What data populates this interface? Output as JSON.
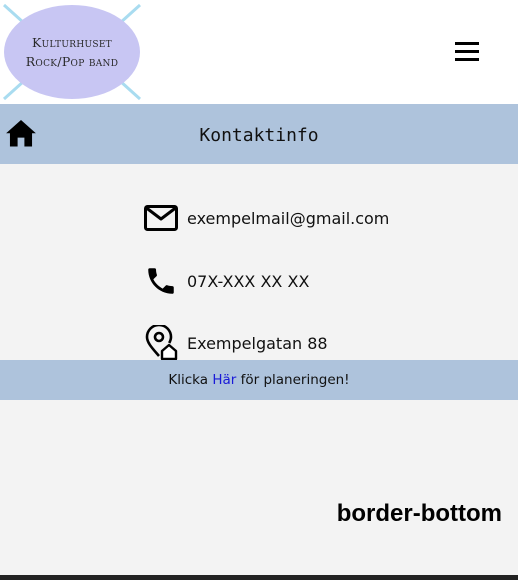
{
  "header": {
    "logo_line1": "Kulturhuset",
    "logo_line2": "Rock/Pop band",
    "logo_color": "#c8c6f3",
    "menu_icon": "hamburger-menu-icon"
  },
  "titlebar": {
    "home_icon": "home-icon",
    "title": "Kontaktinfo",
    "background": "#aec3dc"
  },
  "contact": {
    "email": "exempelmail@gmail.com",
    "phone": "07X-XXX XX XX",
    "address": "Exempelgatan 88",
    "icons": [
      "mail-icon",
      "phone-icon",
      "location-home-icon"
    ]
  },
  "planning": {
    "prefix": "Klicka ",
    "link": "Här",
    "suffix": " för planeringen!",
    "link_color": "#1a1ad8"
  },
  "footer": {
    "label": "border-bottom"
  }
}
